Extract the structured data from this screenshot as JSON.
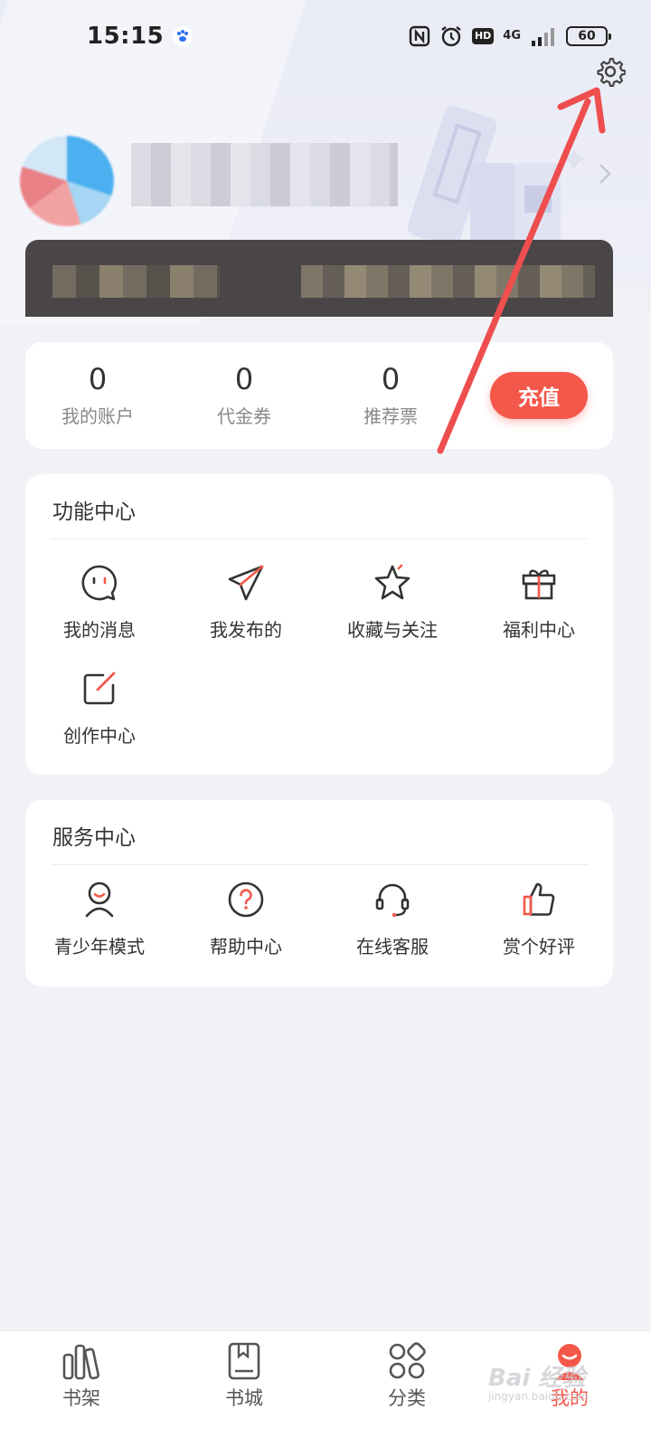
{
  "status_bar": {
    "time": "15:15",
    "network": "4G",
    "hd": "HD",
    "battery": "60"
  },
  "profile": {
    "name": "",
    "vip_left": "",
    "vip_right": ""
  },
  "assets": [
    {
      "value": "0",
      "label": "我的账户"
    },
    {
      "value": "0",
      "label": "代金券"
    },
    {
      "value": "0",
      "label": "推荐票"
    }
  ],
  "recharge_label": "充值",
  "function_center": {
    "title": "功能中心",
    "items": [
      {
        "label": "我的消息",
        "icon": "message-icon"
      },
      {
        "label": "我发布的",
        "icon": "paper-plane-icon"
      },
      {
        "label": "收藏与关注",
        "icon": "star-icon"
      },
      {
        "label": "福利中心",
        "icon": "gift-icon"
      },
      {
        "label": "创作中心",
        "icon": "edit-icon"
      }
    ]
  },
  "service_center": {
    "title": "服务中心",
    "items": [
      {
        "label": "青少年模式",
        "icon": "teen-icon"
      },
      {
        "label": "帮助中心",
        "icon": "help-icon"
      },
      {
        "label": "在线客服",
        "icon": "headset-icon"
      },
      {
        "label": "赏个好评",
        "icon": "thumbs-up-icon"
      }
    ]
  },
  "tabs": [
    {
      "label": "书架",
      "icon": "bookshelf-icon"
    },
    {
      "label": "书城",
      "icon": "bookstore-icon"
    },
    {
      "label": "分类",
      "icon": "category-icon"
    },
    {
      "label": "我的",
      "icon": "profile-icon",
      "active": true
    }
  ],
  "watermark": {
    "text": "Bai 经验",
    "sub": "jingyan.baidu.com"
  },
  "colors": {
    "accent": "#f4584a",
    "background": "#f1f2f7",
    "annotation": "#ee4e4e"
  }
}
